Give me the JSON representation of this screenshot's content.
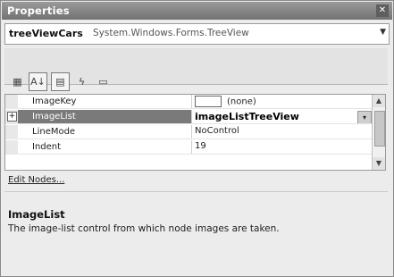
{
  "window": {
    "title": "Properties",
    "close_icon": "close-icon"
  },
  "object_selector": {
    "name": "treeViewCars",
    "type": "System.Windows.Forms.TreeView",
    "dropdown_icon": "chevron-down-icon"
  },
  "toolbar": {
    "buttons": [
      {
        "name": "categorized-icon",
        "glyph": "▦",
        "pressed": false
      },
      {
        "name": "alphabetical-icon",
        "glyph": "A↓",
        "pressed": true
      },
      {
        "name": "properties-icon",
        "glyph": "▤",
        "pressed": true
      },
      {
        "name": "events-icon",
        "glyph": "ϟ",
        "pressed": false
      },
      {
        "name": "property-pages-icon",
        "glyph": "▭",
        "pressed": false
      }
    ]
  },
  "grid": {
    "rows": [
      {
        "name": "ImageKey",
        "value": "(none)",
        "has_swatch": true,
        "expandable": false,
        "selected": false
      },
      {
        "name": "ImageList",
        "value": "imageListTreeView",
        "has_swatch": false,
        "expandable": true,
        "selected": true
      },
      {
        "name": "LineMode",
        "value": "NoControl",
        "has_swatch": false,
        "expandable": false,
        "selected": false
      },
      {
        "name": "Indent",
        "value": "19",
        "has_swatch": false,
        "expandable": false,
        "selected": false
      }
    ],
    "expand_glyph": "+",
    "dropdown_glyph": "▾"
  },
  "commands": {
    "link": "Edit Nodes..."
  },
  "description": {
    "title": "ImageList",
    "text": "The image-list control from which node images are taken."
  }
}
